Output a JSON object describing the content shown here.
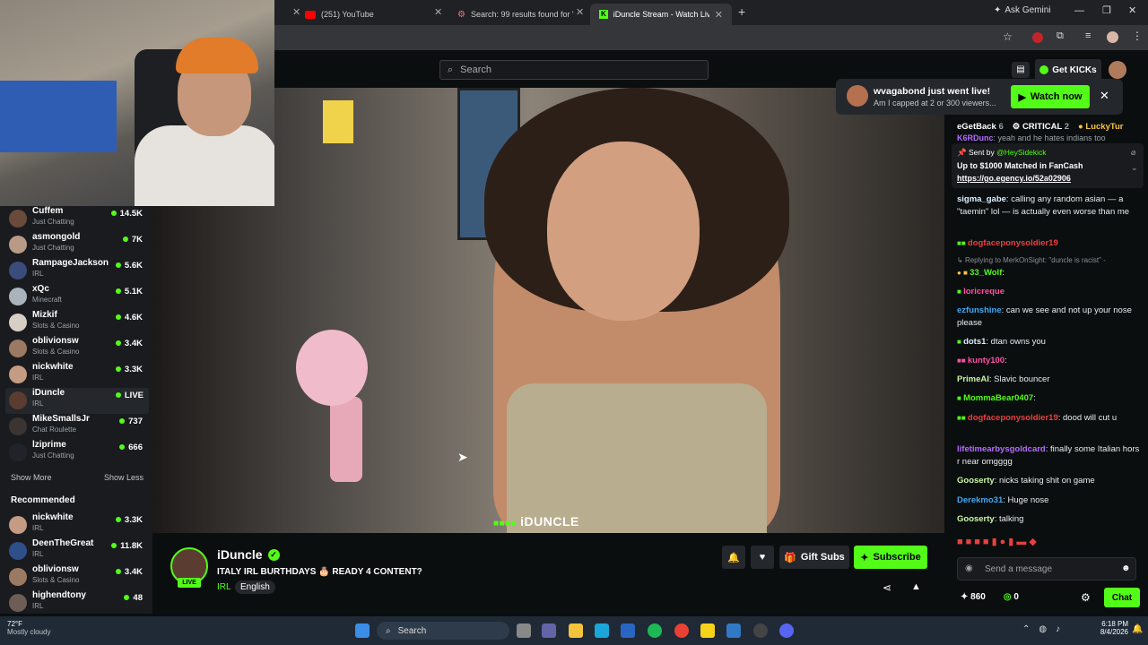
{
  "browser": {
    "tabs": [
      {
        "title": "(251) YouTube"
      },
      {
        "title": "Search: 99 results found for \"pr"
      },
      {
        "title": "iDuncle Stream - Watch Live on"
      }
    ],
    "ask_gemini": "Ask Gemini"
  },
  "header": {
    "search_placeholder": "Search",
    "get_kicks": "Get KICKs"
  },
  "sidebar": {
    "following": [
      {
        "name": "Cuffem",
        "category": "Just Chatting",
        "viewers": "14.5K"
      },
      {
        "name": "asmongold",
        "category": "Just Chatting",
        "viewers": "7K"
      },
      {
        "name": "RampageJackson",
        "category": "IRL",
        "viewers": "5.6K"
      },
      {
        "name": "xQc",
        "category": "Minecraft",
        "viewers": "5.1K"
      },
      {
        "name": "Mizkif",
        "category": "Slots & Casino",
        "viewers": "4.6K"
      },
      {
        "name": "oblivionsw",
        "category": "Slots & Casino",
        "viewers": "3.4K"
      },
      {
        "name": "nickwhite",
        "category": "IRL",
        "viewers": "3.3K"
      },
      {
        "name": "iDuncle",
        "category": "IRL",
        "viewers": "LIVE"
      },
      {
        "name": "MikeSmallsJr",
        "category": "Chat Roulette",
        "viewers": "737"
      },
      {
        "name": "lziprime",
        "category": "Just Chatting",
        "viewers": "666"
      }
    ],
    "show_more": "Show More",
    "show_less": "Show Less",
    "recommended_title": "Recommended",
    "recommended": [
      {
        "name": "nickwhite",
        "category": "IRL",
        "viewers": "3.3K"
      },
      {
        "name": "DeenTheGreat",
        "category": "IRL",
        "viewers": "11.8K"
      },
      {
        "name": "oblivionsw",
        "category": "Slots & Casino",
        "viewers": "3.4K"
      },
      {
        "name": "highendtony",
        "category": "IRL",
        "viewers": "48"
      }
    ]
  },
  "video": {
    "watermark": "iDUNCLE"
  },
  "stream": {
    "live_badge": "LIVE",
    "streamer": "iDuncle",
    "title": "ITALY IRL BURTHDAYS 🎂 READY 4 CONTENT?",
    "category": "IRL",
    "language": "English",
    "gift_subs": "Gift Subs",
    "subscribe": "Subscribe"
  },
  "notification": {
    "title_user": "wvagabond",
    "title_rest": " just went live!",
    "subtitle": "Am I capped at 2 or 300 viewers...",
    "watch_now": "Watch now"
  },
  "chat": {
    "leaderboard": [
      {
        "name": "eGetBack",
        "count": "6"
      },
      {
        "name": "CRITICAL",
        "count": "2"
      },
      {
        "name": "LuckyTur",
        "count": ""
      }
    ],
    "pinned_top": ": yeah and he hates indians too",
    "pinned_top_user": "K6RDunc",
    "pinned_sent_by": "Sent by",
    "pinned_user": "@HeySidekick",
    "pinned_text": "Up to $1000 Matched in FanCash",
    "pinned_link": "https://go.egency.io/52a02906",
    "messages": [
      {
        "user": "sigma_gabe",
        "color": "#d9f0ff",
        "text": ": calling any random asian — a \"taemin\" lol — is actually even worse than me"
      },
      {
        "user": "dogfaceponysoldier19",
        "color": "#e8403e",
        "text": ""
      },
      {
        "user": "Replying to MerkOnSight: \"duncle is racist\" -",
        "color": "#8a8f95",
        "text": ""
      },
      {
        "user": "33_Wolf",
        "color": "#53fc18",
        "text": ":"
      },
      {
        "user": "loricreque",
        "color": "#ff4fa3",
        "text": ""
      },
      {
        "user": "ezfunshine",
        "color": "#3fa9f5",
        "text": ": can we see and not up your nose please"
      },
      {
        "user": "dots1",
        "color": "#d9f0ff",
        "text": ": dtan owns you"
      },
      {
        "user": "kunty100",
        "color": "#ff4fa3",
        "text": ":"
      },
      {
        "user": "PrimeAI",
        "color": "#c9f7a5",
        "text": ": Slavic bouncer"
      },
      {
        "user": "MommaBear0407",
        "color": "#53fc18",
        "text": ":"
      },
      {
        "user": "dogfaceponysoldier19",
        "color": "#e8403e",
        "text": ": dood will cut u"
      },
      {
        "user": "lifetimearbysgoldcard",
        "color": "#b66bff",
        "text": ": finally some Italian hors r near omgggg"
      },
      {
        "user": "Gooserty",
        "color": "#c9f7a5",
        "text": ": nicks taking shit on game"
      },
      {
        "user": "Derekmo31",
        "color": "#3fa9f5",
        "text": ": Huge nose"
      },
      {
        "user": "Gooserty",
        "color": "#c9f7a5",
        "text": ": talking"
      }
    ],
    "placeholder": "Send a message",
    "points": "860",
    "kicks": "0",
    "chat_button": "Chat"
  },
  "taskbar": {
    "weather_temp": "72°F",
    "weather_desc": "Mostly cloudy",
    "search": "Search",
    "time": "6:18 PM",
    "date": "8/4/2026"
  },
  "colors": {
    "accent": "#53fc18",
    "bg": "#0b0e0f",
    "panel": "#191b1f"
  }
}
